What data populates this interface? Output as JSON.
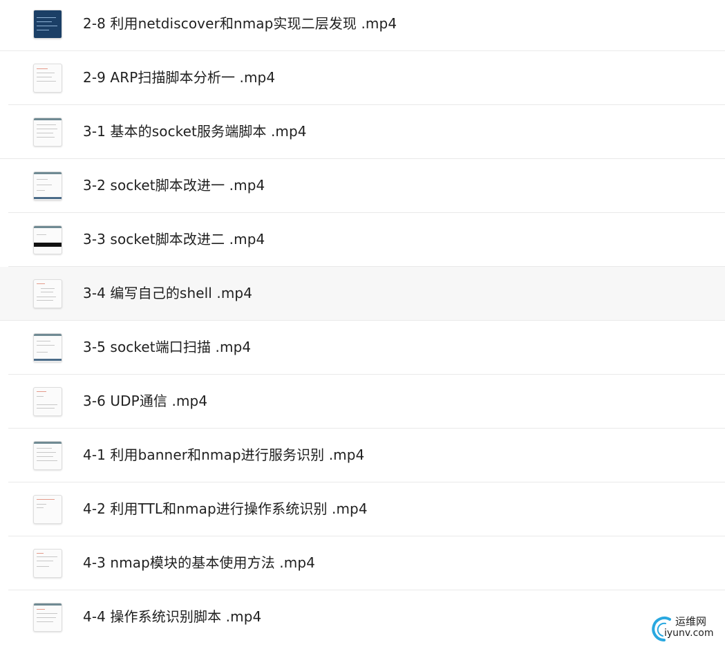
{
  "files": [
    {
      "name": "2-8 利用netdiscover和nmap实现二层发现 .mp4",
      "thumb": "dark"
    },
    {
      "name": "2-9 ARP扫描脚本分析一 .mp4",
      "thumb": "doc"
    },
    {
      "name": "3-1 基本的socket服务端脚本 .mp4",
      "thumb": "doc"
    },
    {
      "name": "3-2 socket脚本改进一 .mp4",
      "thumb": "doc"
    },
    {
      "name": "3-3 socket脚本改进二 .mp4",
      "thumb": "term"
    },
    {
      "name": "3-4 编写自己的shell .mp4",
      "thumb": "doc"
    },
    {
      "name": "3-5 socket端口扫描 .mp4",
      "thumb": "doc"
    },
    {
      "name": "3-6 UDP通信 .mp4",
      "thumb": "doc"
    },
    {
      "name": "4-1 利用banner和nmap进行服务识别 .mp4",
      "thumb": "doc"
    },
    {
      "name": "4-2 利用TTL和nmap进行操作系统识别 .mp4",
      "thumb": "doc"
    },
    {
      "name": "4-3 nmap模块的基本使用方法 .mp4",
      "thumb": "doc"
    },
    {
      "name": "4-4 操作系统识别脚本 .mp4",
      "thumb": "doc"
    }
  ],
  "watermark": {
    "top": "运维网",
    "bottom": "iyunv.com"
  }
}
